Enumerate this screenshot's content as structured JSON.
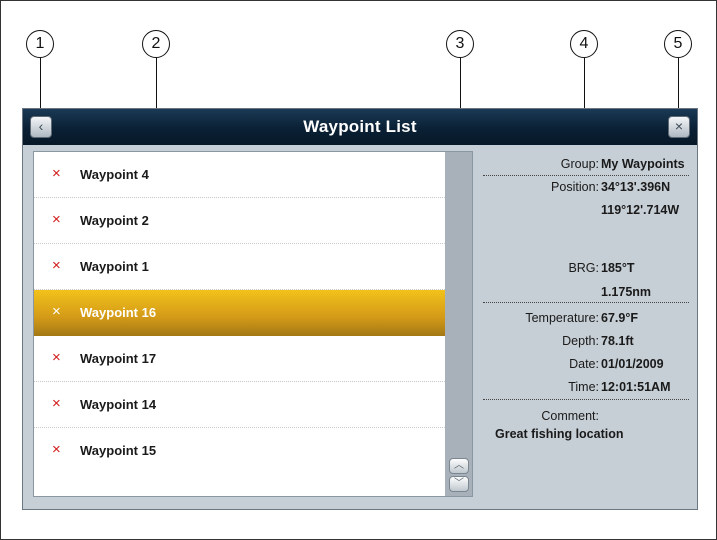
{
  "callouts": [
    "1",
    "2",
    "3",
    "4",
    "5"
  ],
  "header": {
    "title": "Waypoint List",
    "back_icon": "back-icon",
    "close_icon": "close-icon"
  },
  "waypoints": [
    {
      "name": "Waypoint 4",
      "selected": false
    },
    {
      "name": "Waypoint 2",
      "selected": false
    },
    {
      "name": "Waypoint 1",
      "selected": false
    },
    {
      "name": "Waypoint 16",
      "selected": true
    },
    {
      "name": "Waypoint 17",
      "selected": false
    },
    {
      "name": "Waypoint 14",
      "selected": false
    },
    {
      "name": "Waypoint 15",
      "selected": false
    }
  ],
  "waypoint_marker": "×",
  "details": {
    "group_label": "Group:",
    "group_value": "My Waypoints",
    "position_label": "Position:",
    "position_lat": "34°13'.396N",
    "position_lon": "119°12'.714W",
    "brg_label": "BRG:",
    "brg_value": "185°T",
    "distance_value": "1.175nm",
    "temperature_label": "Temperature:",
    "temperature_value": "67.9°F",
    "depth_label": "Depth:",
    "depth_value": "78.1ft",
    "date_label": "Date:",
    "date_value": "01/01/2009",
    "time_label": "Time:",
    "time_value": "12:01:51AM",
    "comment_label": "Comment:",
    "comment_value": "Great fishing location"
  },
  "colors": {
    "titlebar": "#0a2034",
    "selected_row": "#e0aa18",
    "marker": "#d21a1a",
    "panel": "#c7cfd6"
  }
}
